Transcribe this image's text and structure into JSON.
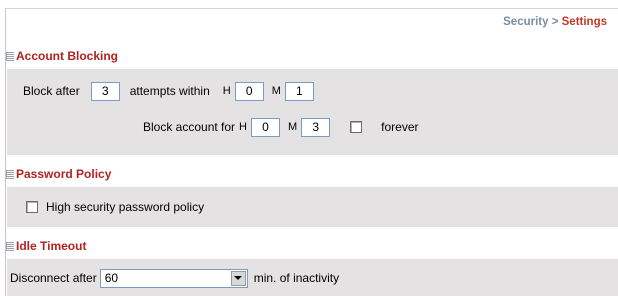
{
  "breadcrumb": {
    "parent": "Security",
    "separator": " > ",
    "current": "Settings"
  },
  "account_blocking": {
    "title": "Account Blocking",
    "block_after_label": "Block after",
    "block_after_value": "3",
    "attempts_within_label": "attempts within",
    "h_label": "H",
    "m_label": "M",
    "attempts_hours": "0",
    "attempts_minutes": "1",
    "block_account_for_label": "Block account for",
    "block_hours": "0",
    "block_minutes": "3",
    "forever_label": "forever",
    "forever_checked": false
  },
  "password_policy": {
    "title": "Password Policy",
    "high_security_label": "High security password policy",
    "high_security_checked": false
  },
  "idle_timeout": {
    "title": "Idle Timeout",
    "disconnect_after_label": "Disconnect after",
    "selected_value": "60",
    "suffix_label": "min. of inactivity"
  }
}
